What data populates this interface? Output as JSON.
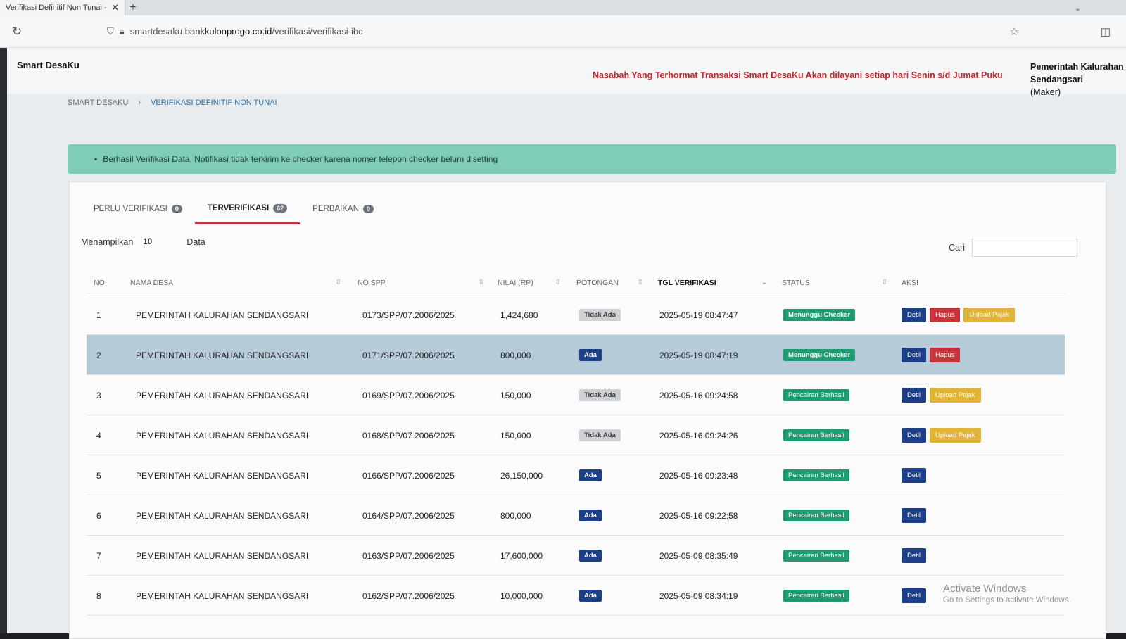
{
  "browser": {
    "tab_title": "Verifikasi Definitif Non Tunai - S",
    "url_prefix": "smartdesaku.",
    "url_domain": "bankkulonprogo.co.id",
    "url_path": "/verifikasi/verifikasi-ibc"
  },
  "app": {
    "brand": "Smart DesaKu",
    "marquee": "Nasabah Yang Terhormat Transaksi Smart DesaKu Akan dilayani setiap hari Senin s/d Jumat Puku",
    "account_name_1": "Pemerintah Kalurahan",
    "account_name_2": "Sendangsari",
    "account_role": "(Maker)"
  },
  "breadcrumb": {
    "root": "SMART DESAKU",
    "separator": "›",
    "current": "VERIFIKASI DEFINITIF NON TUNAI"
  },
  "alert": {
    "message": "Berhasil Verifikasi Data, Notifikasi tidak terkirim ke checker karena nomer telepon checker belum disetting"
  },
  "tabs": [
    {
      "label": "PERLU VERIFIKASI",
      "count": "0"
    },
    {
      "label": "TERVERIFIKASI",
      "count": "62"
    },
    {
      "label": "PERBAIKAN",
      "count": "0"
    }
  ],
  "length": {
    "prefix": "Menampilkan",
    "value": "10",
    "suffix": "Data"
  },
  "search": {
    "label": "Cari",
    "value": ""
  },
  "columns": {
    "no": "NO",
    "nama_desa": "NAMA DESA",
    "no_spp": "NO SPP",
    "nilai": "NILAI (RP)",
    "potongan": "POTONGAN",
    "tgl": "TGL VERIFIKASI",
    "status": "STATUS",
    "aksi": "AKSI"
  },
  "rows": [
    {
      "no": "1",
      "desa": "PEMERINTAH KALURAHAN SENDANGSARI",
      "spp": "0173/SPP/07.2006/2025",
      "nilai": "1,424,680",
      "potongan": "Tidak Ada",
      "tgl": "2025-05-19 08:47:47",
      "status": "Menunggu Checker",
      "detil": "Detil",
      "hapus": "Hapus",
      "pajak": "Upload Pajak"
    },
    {
      "no": "2",
      "desa": "PEMERINTAH KALURAHAN SENDANGSARI",
      "spp": "0171/SPP/07.2006/2025",
      "nilai": "800,000",
      "potongan": "Ada",
      "tgl": "2025-05-19 08:47:19",
      "status": "Menunggu Checker",
      "detil": "Detil",
      "hapus": "Hapus",
      "pajak": ""
    },
    {
      "no": "3",
      "desa": "PEMERINTAH KALURAHAN SENDANGSARI",
      "spp": "0169/SPP/07.2006/2025",
      "nilai": "150,000",
      "potongan": "Tidak Ada",
      "tgl": "2025-05-16 09:24:58",
      "status": "Pencairan Berhasil",
      "detil": "Detil",
      "hapus": "",
      "pajak": "Upload Pajak"
    },
    {
      "no": "4",
      "desa": "PEMERINTAH KALURAHAN SENDANGSARI",
      "spp": "0168/SPP/07.2006/2025",
      "nilai": "150,000",
      "potongan": "Tidak Ada",
      "tgl": "2025-05-16 09:24:26",
      "status": "Pencairan Berhasil",
      "detil": "Detil",
      "hapus": "",
      "pajak": "Upload Pajak"
    },
    {
      "no": "5",
      "desa": "PEMERINTAH KALURAHAN SENDANGSARI",
      "spp": "0166/SPP/07.2006/2025",
      "nilai": "26,150,000",
      "potongan": "Ada",
      "tgl": "2025-05-16 09:23:48",
      "status": "Pencairan Berhasil",
      "detil": "Detil",
      "hapus": "",
      "pajak": ""
    },
    {
      "no": "6",
      "desa": "PEMERINTAH KALURAHAN SENDANGSARI",
      "spp": "0164/SPP/07.2006/2025",
      "nilai": "800,000",
      "potongan": "Ada",
      "tgl": "2025-05-16 09:22:58",
      "status": "Pencairan Berhasil",
      "detil": "Detil",
      "hapus": "",
      "pajak": ""
    },
    {
      "no": "7",
      "desa": "PEMERINTAH KALURAHAN SENDANGSARI",
      "spp": "0163/SPP/07.2006/2025",
      "nilai": "17,600,000",
      "potongan": "Ada",
      "tgl": "2025-05-09 08:35:49",
      "status": "Pencairan Berhasil",
      "detil": "Detil",
      "hapus": "",
      "pajak": ""
    },
    {
      "no": "8",
      "desa": "PEMERINTAH KALURAHAN SENDANGSARI",
      "spp": "0162/SPP/07.2006/2025",
      "nilai": "10,000,000",
      "potongan": "Ada",
      "tgl": "2025-05-09 08:34:19",
      "status": "Pencairan Berhasil",
      "detil": "Detil",
      "hapus": "",
      "pajak": ""
    }
  ],
  "selected_row": 2,
  "watermark": {
    "line1": "Activate Windows",
    "line2": "Go to Settings to activate Windows."
  },
  "colors": {
    "accent_red": "#c8333a",
    "primary": "#1d3f87",
    "success": "#1f9b72",
    "warning": "#e1b337",
    "marquee": "#c0282e"
  }
}
